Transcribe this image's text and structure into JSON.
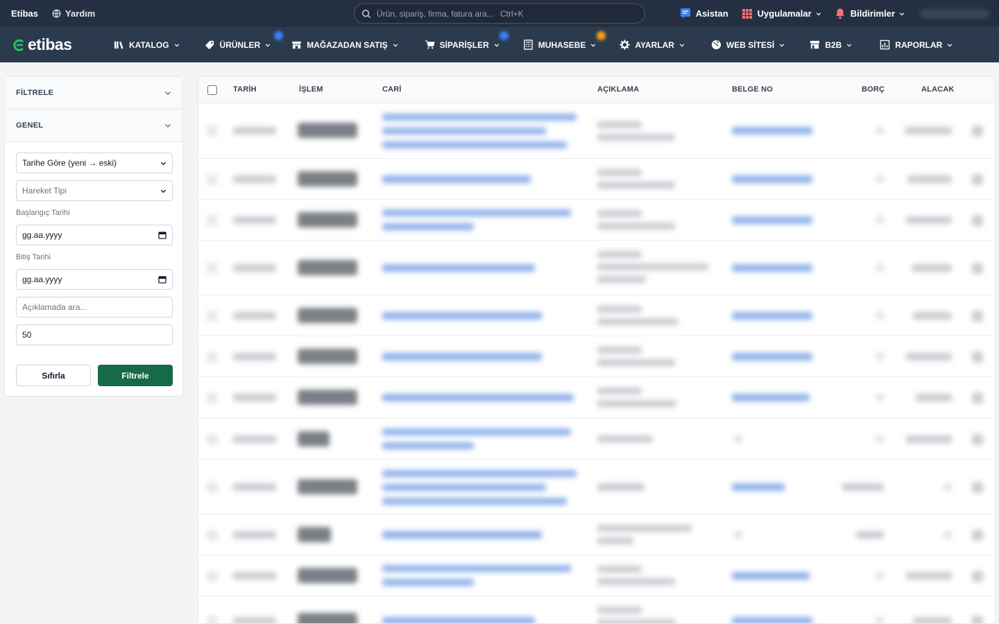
{
  "topbar": {
    "brand": "Etibas",
    "help": "Yardım",
    "search_placeholder": "Ürün, sipariş, firma, fatura ara...",
    "search_shortcut": "Ctrl+K",
    "assistant": "Asistan",
    "apps": "Uygulamalar",
    "notifications": "Bildirimler"
  },
  "nav": {
    "logo": "etibas",
    "items": [
      "KATALOG",
      "ÜRÜNLER",
      "MAĞAZADAN SATIŞ",
      "SİPARİŞLER",
      "MUHASEBE",
      "AYARLAR",
      "WEB SİTESİ",
      "B2B",
      "RAPORLAR"
    ]
  },
  "filters": {
    "header": "FİLTRELE",
    "section": "GENEL",
    "sort_value": "Tarihe Göre (yeni → eski)",
    "type_placeholder": "Hareket Tipi",
    "start_label": "Başlangıç Tarihi",
    "start_placeholder": "gg.aa.yyyy",
    "end_label": "Bitiş Tarihi",
    "end_placeholder": "gg.aa.yyyy",
    "desc_placeholder": "Açıklamada ara...",
    "limit_value": "50",
    "reset_label": "Sıfırla",
    "apply_label": "Filtrele"
  },
  "table": {
    "columns": [
      "TARİH",
      "İŞLEM",
      "CARİ",
      "AÇIKLAMA",
      "BELGE NO",
      "BORÇ",
      "ALACAK"
    ]
  },
  "colors": {
    "topbar": "#243042",
    "navbar": "#2c3a4e",
    "accent_green": "#166a4a",
    "logo_green": "#22c55e"
  }
}
